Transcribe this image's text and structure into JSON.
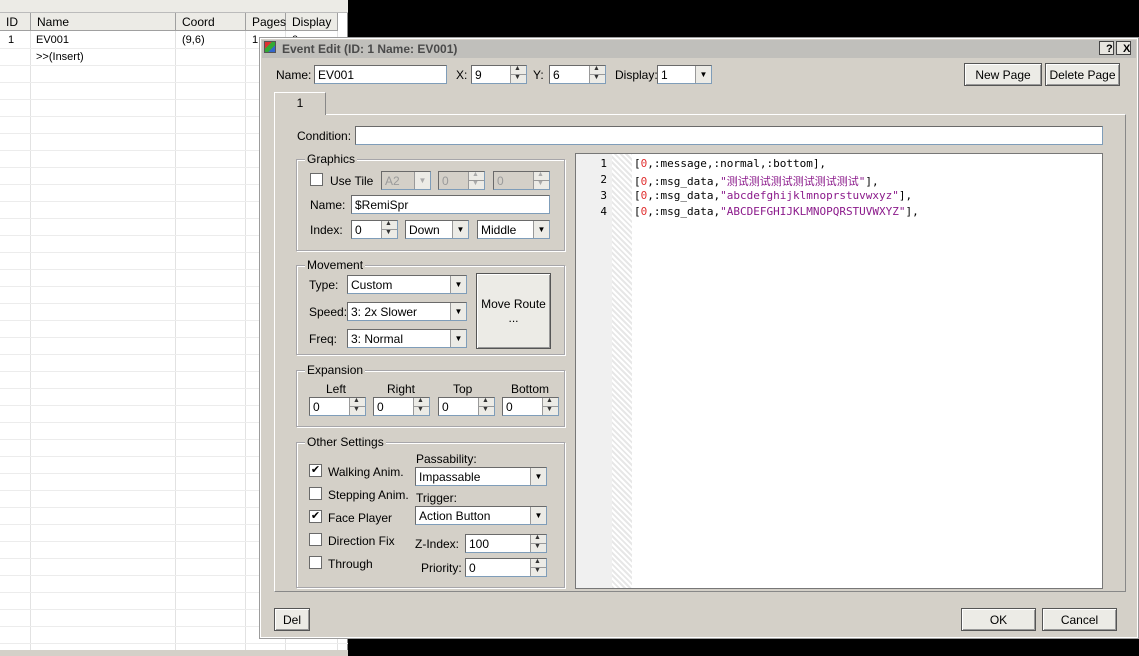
{
  "list": {
    "headers": [
      "ID",
      "Name",
      "Coord",
      "Pages",
      "Display"
    ],
    "rows": [
      {
        "id": "1",
        "name": "EV001",
        "coord": "(9,6)",
        "pages": "1",
        "display": "0"
      },
      {
        "id": "",
        "name": ">>(Insert)",
        "coord": "",
        "pages": "",
        "display": ""
      }
    ]
  },
  "dialog": {
    "title": "Event Edit (ID: 1 Name: EV001)",
    "help_label": "?",
    "close_label": "X",
    "name_label": "Name:",
    "name_value": "EV001",
    "x_label": "X:",
    "x_value": "9",
    "y_label": "Y:",
    "y_value": "6",
    "display_label": "Display:",
    "display_value": "1",
    "new_page_label": "New Page",
    "delete_page_label": "Delete Page",
    "tab_label": "1",
    "condition_label": "Condition:",
    "condition_value": "",
    "graphics": {
      "title": "Graphics",
      "use_tile_label": "Use Tile",
      "use_tile_checked": false,
      "tile_value": "A2",
      "tile_x": "0",
      "tile_y": "0",
      "name_label": "Name:",
      "name_value": "$RemiSpr",
      "index_label": "Index:",
      "index_value": "0",
      "direction_value": "Down",
      "pattern_value": "Middle"
    },
    "movement": {
      "title": "Movement",
      "type_label": "Type:",
      "type_value": "Custom",
      "speed_label": "Speed:",
      "speed_value": "3: 2x Slower",
      "freq_label": "Freq:",
      "freq_value": "3: Normal",
      "move_route_label": "Move Route",
      "move_route_ellipsis": "..."
    },
    "expansion": {
      "title": "Expansion",
      "left_label": "Left",
      "left_value": "0",
      "right_label": "Right",
      "right_value": "0",
      "top_label": "Top",
      "top_value": "0",
      "bottom_label": "Bottom",
      "bottom_value": "0"
    },
    "other": {
      "title": "Other Settings",
      "walking_label": "Walking Anim.",
      "walking_checked": true,
      "stepping_label": "Stepping Anim.",
      "stepping_checked": false,
      "face_label": "Face Player",
      "face_checked": true,
      "dirfix_label": "Direction Fix",
      "dirfix_checked": false,
      "through_label": "Through",
      "through_checked": false,
      "passability_label": "Passability:",
      "passability_value": "Impassable",
      "trigger_label": "Trigger:",
      "trigger_value": "Action Button",
      "zindex_label": "Z-Index:",
      "zindex_value": "100",
      "priority_label": "Priority:",
      "priority_value": "0"
    },
    "code_lines": [
      {
        "n": "1",
        "pre": "[",
        "num": "0",
        "mid": ",:message,:normal,:bottom],",
        "str": "",
        "post": ""
      },
      {
        "n": "2",
        "pre": "[",
        "num": "0",
        "mid": ",:msg_data,",
        "str": "\"测试测试测试测试测试测试\"",
        "post": "],"
      },
      {
        "n": "3",
        "pre": "[",
        "num": "0",
        "mid": ",:msg_data,",
        "str": "\"abcdefghijklmnoprstuvwxyz\"",
        "post": "],"
      },
      {
        "n": "4",
        "pre": "[",
        "num": "0",
        "mid": ",:msg_data,",
        "str": "\"ABCDEFGHIJKLMNOPQRSTUVWXYZ\"",
        "post": "],"
      }
    ],
    "del_label": "Del",
    "ok_label": "OK",
    "cancel_label": "Cancel"
  }
}
